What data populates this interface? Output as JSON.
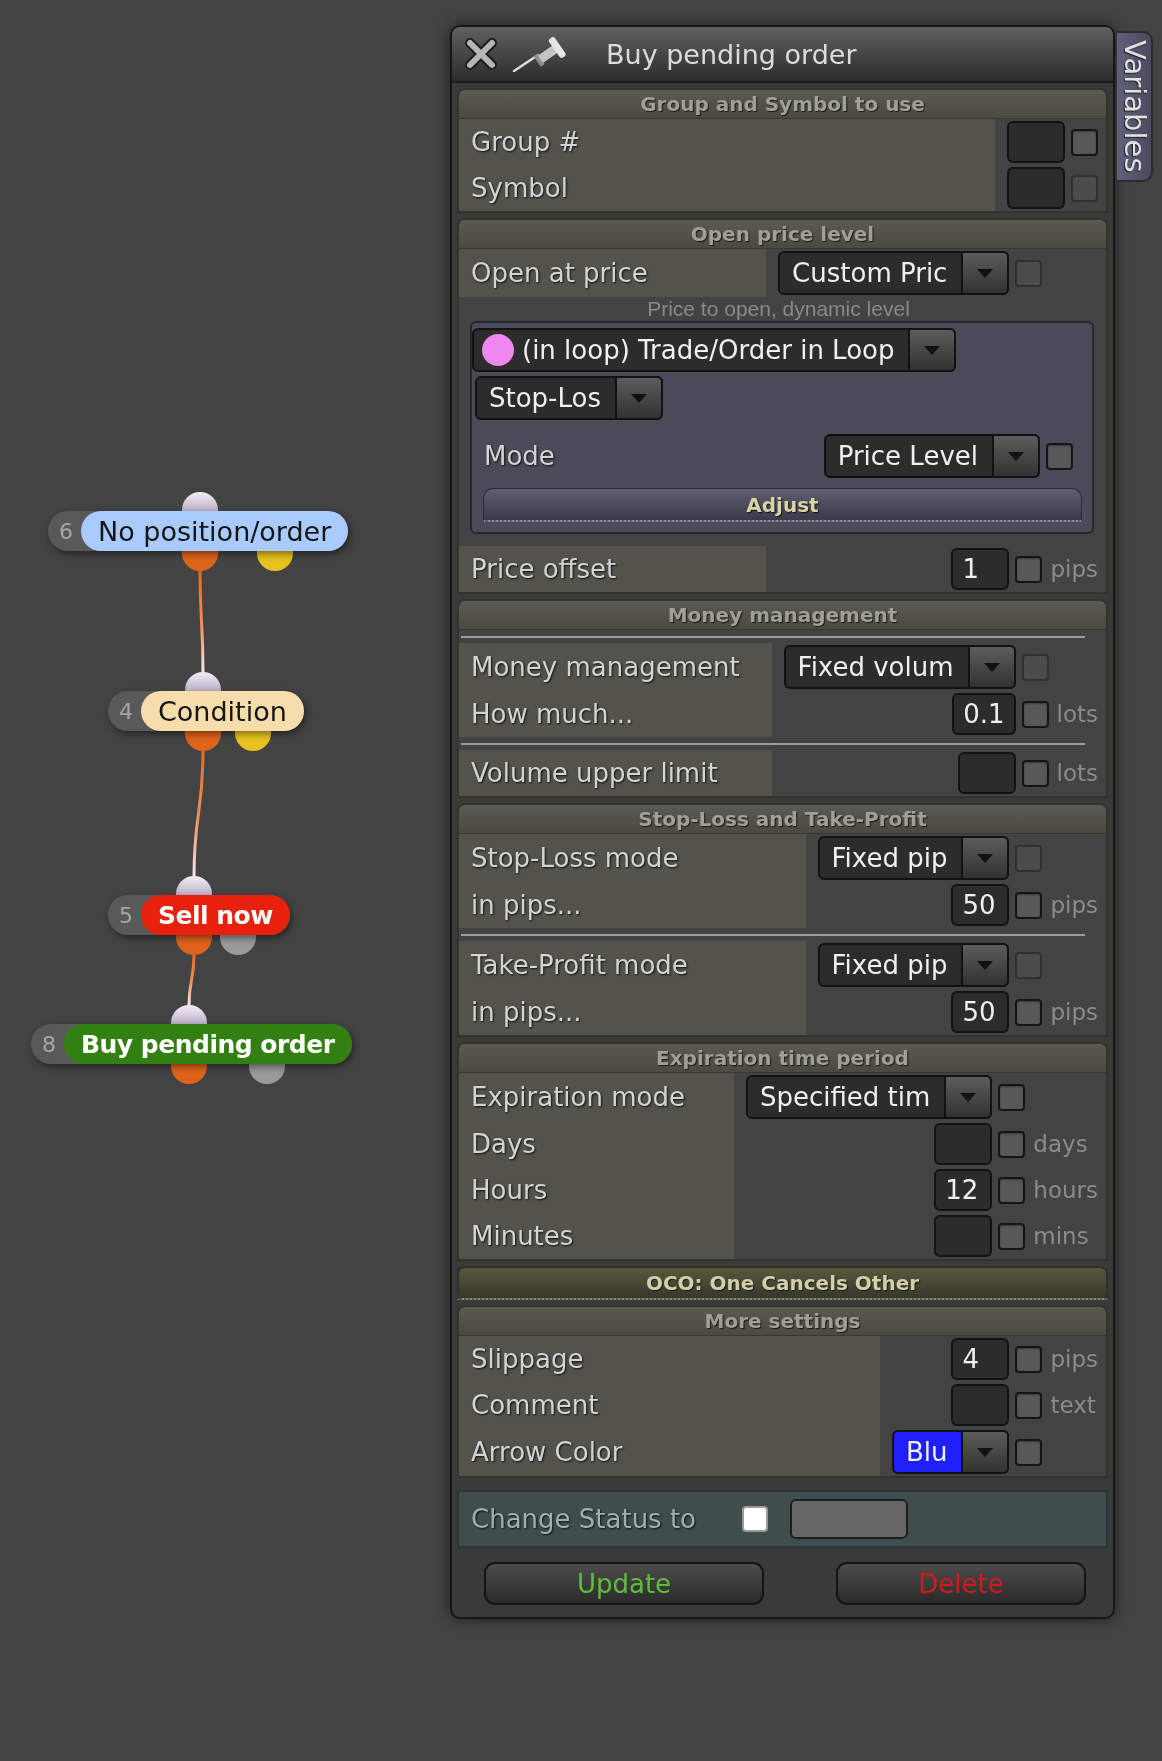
{
  "canvas": {
    "nodes": [
      {
        "number": "6",
        "label": "No position/order",
        "color": "#aacbff",
        "outputs": [
          {
            "color": "#e0631c"
          },
          {
            "color": "#e8c21f"
          }
        ]
      },
      {
        "number": "4",
        "label": "Condition",
        "color": "#f7dcac",
        "outputs": [
          {
            "color": "#e0631c"
          },
          {
            "color": "#e8c21f"
          }
        ]
      },
      {
        "number": "5",
        "label": "Sell now",
        "color": "#e8200e",
        "outputs": [
          {
            "color": "#e0631c"
          },
          {
            "color": "#9a9a9a"
          }
        ]
      },
      {
        "number": "8",
        "label": "Buy pending order",
        "color": "#338012",
        "outputs": [
          {
            "color": "#e0631c"
          },
          {
            "color": "#9a9a9a"
          }
        ]
      }
    ]
  },
  "panel": {
    "title": "Buy pending order",
    "side_tab": "Variables",
    "sections": [
      {
        "title": "Group and Symbol to use",
        "expanded": true,
        "rows": [
          {
            "kind": "field",
            "label": "Group #",
            "control": {
              "kind": "input"
            },
            "checkbox": {
              "checked": false,
              "disabled": false
            }
          },
          {
            "kind": "field",
            "label": "Symbol",
            "control": {
              "kind": "input"
            },
            "checkbox": {
              "checked": false,
              "disabled": true
            }
          }
        ]
      },
      {
        "title": "Open price level",
        "expanded": true,
        "rows": [
          {
            "kind": "field",
            "label": "Open at price",
            "control": {
              "kind": "select",
              "value": "Custom Pric"
            },
            "checkbox": {
              "checked": false,
              "disabled": true
            }
          },
          {
            "kind": "hint",
            "text": "Price to open, dynamic level"
          },
          {
            "kind": "group",
            "rows": [
              {
                "kind": "select-row",
                "control": {
                  "kind": "select",
                  "value": "(in loop) Trade/Order in Loop",
                  "color": "#ee88ee"
                }
              },
              {
                "kind": "select-row",
                "control": {
                  "kind": "select",
                  "value": "Stop-Los"
                }
              },
              {
                "kind": "field",
                "label": "Mode",
                "control": {
                  "kind": "select",
                  "value": "Price Level"
                },
                "checkbox": {
                  "checked": false,
                  "disabled": false
                }
              },
              {
                "kind": "button",
                "label": "Adjust"
              }
            ]
          },
          {
            "kind": "field",
            "label": "Price offset",
            "control": {
              "kind": "input",
              "value": "1"
            },
            "checkbox": {
              "checked": false,
              "disabled": false
            },
            "unit": "pips"
          }
        ]
      },
      {
        "title": "Money management",
        "expanded": true,
        "rows": [
          {
            "kind": "divider"
          },
          {
            "kind": "field",
            "label": "Money management",
            "control": {
              "kind": "select",
              "value": "Fixed volum"
            },
            "checkbox": {
              "checked": false,
              "disabled": true
            }
          },
          {
            "kind": "field",
            "label": "How much...",
            "control": {
              "kind": "input",
              "value": "0.1"
            },
            "checkbox": {
              "checked": false,
              "disabled": false
            },
            "unit": "lots"
          },
          {
            "kind": "divider"
          },
          {
            "kind": "field",
            "label": "Volume upper limit",
            "control": {
              "kind": "input"
            },
            "checkbox": {
              "checked": false,
              "disabled": false
            },
            "unit": "lots"
          }
        ]
      },
      {
        "title": "Stop-Loss and Take-Profit",
        "expanded": true,
        "rows": [
          {
            "kind": "field",
            "label": "Stop-Loss mode",
            "control": {
              "kind": "select",
              "value": "Fixed pip"
            },
            "checkbox": {
              "checked": false,
              "disabled": true
            }
          },
          {
            "kind": "field",
            "label": "in pips...",
            "control": {
              "kind": "input",
              "value": "50"
            },
            "checkbox": {
              "checked": false,
              "disabled": false
            },
            "unit": "pips"
          },
          {
            "kind": "divider"
          },
          {
            "kind": "field",
            "label": "Take-Profit mode",
            "control": {
              "kind": "select",
              "value": "Fixed pip"
            },
            "checkbox": {
              "checked": false,
              "disabled": true
            }
          },
          {
            "kind": "field",
            "label": "in pips...",
            "control": {
              "kind": "input",
              "value": "50"
            },
            "checkbox": {
              "checked": false,
              "disabled": false
            },
            "unit": "pips"
          }
        ]
      },
      {
        "title": "Expiration time period",
        "expanded": true,
        "rows": [
          {
            "kind": "field",
            "label": "Expiration mode",
            "control": {
              "kind": "select",
              "value": "Specified tim"
            },
            "checkbox": {
              "checked": false,
              "disabled": false
            }
          },
          {
            "kind": "field",
            "label": "Days",
            "control": {
              "kind": "input"
            },
            "checkbox": {
              "checked": false,
              "disabled": false
            },
            "unit": "days"
          },
          {
            "kind": "field",
            "label": "Hours",
            "control": {
              "kind": "input",
              "value": "12"
            },
            "checkbox": {
              "checked": false,
              "disabled": false
            },
            "unit": "hours"
          },
          {
            "kind": "field",
            "label": "Minutes",
            "control": {
              "kind": "input"
            },
            "checkbox": {
              "checked": false,
              "disabled": false
            },
            "unit": "mins"
          }
        ]
      },
      {
        "title": "OCO: One Cancels Other",
        "expanded": false
      },
      {
        "title": "More settings",
        "expanded": true,
        "rows": [
          {
            "kind": "field",
            "label": "Slippage",
            "control": {
              "kind": "input",
              "value": "4"
            },
            "checkbox": {
              "checked": false,
              "disabled": false
            },
            "unit": "pips"
          },
          {
            "kind": "field",
            "label": "Comment",
            "control": {
              "kind": "input"
            },
            "checkbox": {
              "checked": false,
              "disabled": false
            },
            "unit": "text"
          },
          {
            "kind": "field",
            "label": "Arrow Color",
            "control": {
              "kind": "color-select",
              "value": "Blu",
              "color": "#1f1ffa"
            },
            "checkbox": {
              "checked": false,
              "disabled": false
            }
          }
        ]
      }
    ],
    "status": {
      "label": "Change Status to",
      "checkbox": {
        "checked": false
      },
      "control": {
        "kind": "input"
      }
    },
    "buttons": [
      {
        "kind": "update",
        "label": "Update"
      },
      {
        "kind": "delete",
        "label": "Delete"
      }
    ]
  }
}
